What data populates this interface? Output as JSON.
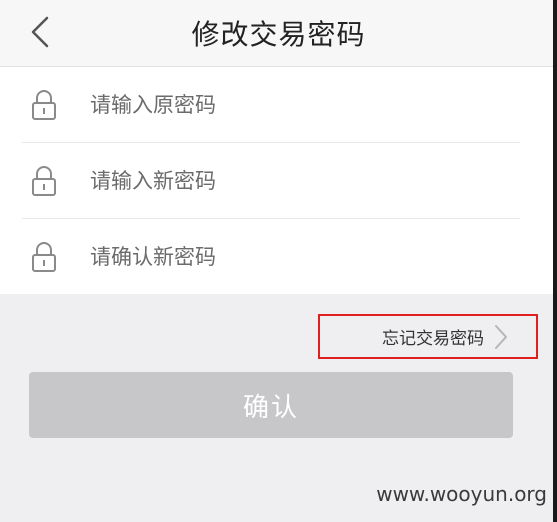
{
  "header": {
    "title": "修改交易密码",
    "back_icon": "chevron-left-icon"
  },
  "form": {
    "fields": [
      {
        "placeholder": "请输入原密码",
        "value": "",
        "icon": "lock-icon"
      },
      {
        "placeholder": "请输入新密码",
        "value": "",
        "icon": "lock-icon"
      },
      {
        "placeholder": "请确认新密码",
        "value": "",
        "icon": "lock-icon"
      }
    ]
  },
  "forgot": {
    "label": "忘记交易密码",
    "icon": "chevron-right-icon"
  },
  "confirm": {
    "label": "确认",
    "state": "disabled"
  },
  "watermark": "www.wooyun.org",
  "colors": {
    "background": "#efeff1",
    "button_disabled": "#c7c7c9",
    "highlight_box": "#e02020"
  }
}
